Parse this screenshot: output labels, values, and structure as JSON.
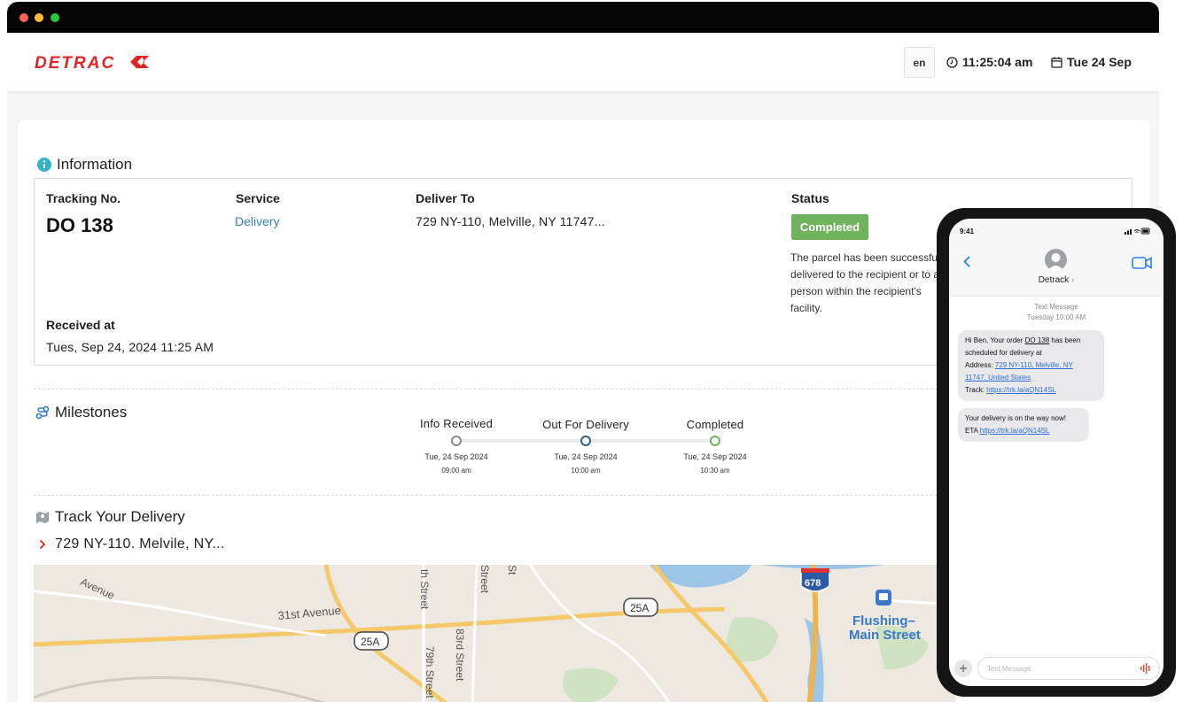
{
  "header": {
    "logo_text": "DETRACK",
    "language": "en",
    "time": "11:25:04 am",
    "date": "Tue 24 Sep",
    "brand_color": "#e02424"
  },
  "information": {
    "title": "Information",
    "tracking_label": "Tracking No.",
    "tracking_value": "DO 138",
    "service_label": "Service",
    "service_value": "Delivery",
    "deliver_to_label": "Deliver To",
    "deliver_to_value": "729 NY-110, Melville, NY 11747...",
    "status_label": "Status",
    "status_value": "Completed",
    "status_color": "#6fb35c",
    "status_description": "The parcel has been successfully delivered to the recipient or to a person within the recipient's facility.",
    "received_label": "Received at",
    "received_value": "Tues, Sep 24, 2024 11:25 AM"
  },
  "milestones": {
    "title": "Milestones",
    "steps": [
      {
        "label": "Info Received",
        "date": "Tue, 24 Sep 2024",
        "time": "09:00 am",
        "color": "#8a8a8a"
      },
      {
        "label": "Out For Delivery",
        "date": "Tue, 24 Sep 2024",
        "time": "10:00 am",
        "color": "#2f5f86"
      },
      {
        "label": "Completed",
        "date": "Tue, 24 Sep 2024",
        "time": "10:30 am",
        "color": "#6fb35c"
      }
    ]
  },
  "track": {
    "title": "Track Your Delivery",
    "address": "729 NY-110. Melvile, NY..."
  },
  "map": {
    "labels": {
      "avenue_top": "Avenue",
      "avenue_31": "31st Avenue",
      "route_25a_left": "25A",
      "route_25a_right": "25A",
      "street_79": "79th Street",
      "street_83": "83rd Street",
      "street_top_1": "th Street",
      "street_top_2": "Street",
      "street_top_3": "St",
      "interstate": "678",
      "flushing": "Flushing–",
      "main_street": "Main Street",
      "street_bottom": "Stre"
    }
  },
  "phone": {
    "status_time": "9:41",
    "contact_name": "Detrack",
    "meta_type": "Text Message",
    "meta_time": "Tuesday 10:00 AM",
    "message1": {
      "l1": "Hi Ben, Your order ",
      "order": "DO 138",
      "l1b": " has been",
      "l2": "scheduled for delivery at",
      "l3": "Address: ",
      "addr1": "729 NY-110, Melville, NY",
      "addr2": "11747, United States",
      "l5": "Track: ",
      "link": "https://trk.la/aQN14SL"
    },
    "message2": {
      "l1": "Your delivery is on the way now!",
      "l2": "ETA ",
      "link": "https://trk.la/aQN14SL"
    },
    "input_placeholder": "Text Message"
  }
}
